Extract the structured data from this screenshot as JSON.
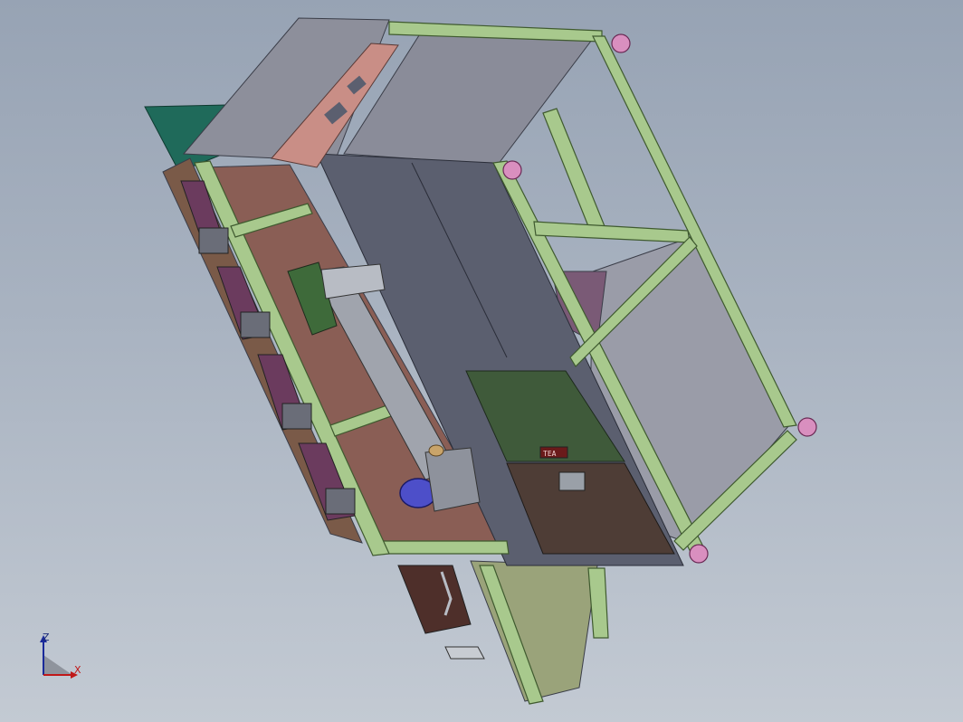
{
  "view": {
    "background_top": "#97a3b4",
    "background_bottom": "#c3cad3"
  },
  "model": {
    "colors": {
      "frame_green": "#a8c98d",
      "frame_green_dark": "#6f8f57",
      "panel_gray": "#8a8c99",
      "panel_dark": "#5b5f6f",
      "copper_plate": "#c98e86",
      "brown_panel": "#8a5e55",
      "dark_green_door": "#3f5a3a",
      "dark_brown_door": "#4e3d36",
      "motor_blue": "#4d4fc9",
      "caster_pink": "#d98fbf",
      "teal_panel": "#1f6a5a",
      "purple_strip": "#6b3b5e"
    },
    "door_label": "TEA"
  },
  "triad": {
    "z_label": "Z",
    "x_label": "X"
  }
}
